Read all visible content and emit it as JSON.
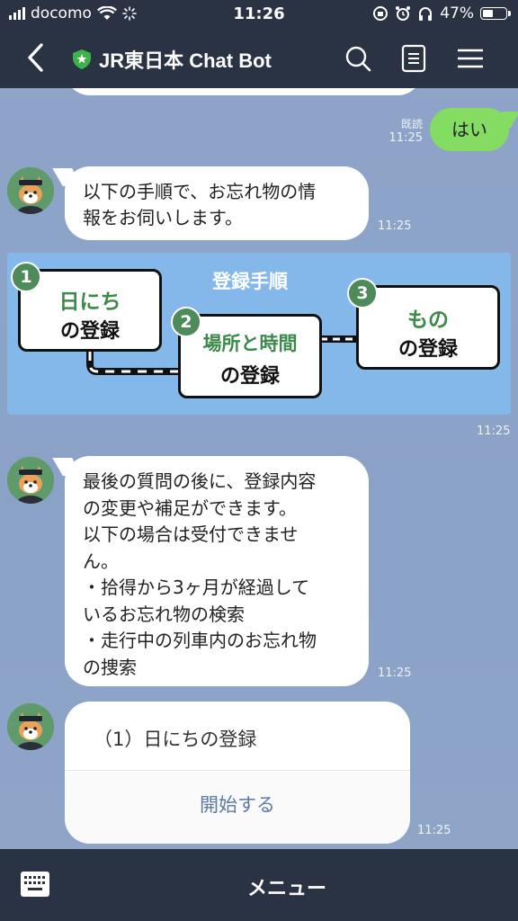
{
  "status_bar": {
    "carrier": "docomo",
    "time": "11:26",
    "battery": "47%"
  },
  "header": {
    "title": "JR東日本 Chat Bot"
  },
  "messages": {
    "prev_partial": "はい",
    "user_reply": {
      "text": "はい",
      "read_label": "既読",
      "time": "11:25"
    },
    "bot_intro": {
      "lines": [
        "以下の手順で、お忘れ物の情",
        "報をお伺いします。"
      ],
      "time": "11:25"
    },
    "banner": {
      "title": "登録手順",
      "steps": [
        {
          "num": "1",
          "line1": "日にち",
          "line2": "の登録"
        },
        {
          "num": "2",
          "line1": "場所と時間",
          "line2": "の登録"
        },
        {
          "num": "3",
          "line1": "もの",
          "line2": "の登録"
        }
      ],
      "time": "11:25"
    },
    "bot_notice": {
      "lines": [
        "最後の質問の後に、登録内容",
        "の変更や補足ができます。",
        "以下の場合は受付できませ",
        "ん。",
        "・拾得から3ヶ月が経過して",
        "いるお忘れ物の検索",
        "・走行中の列車内のお忘れ物",
        "の捜索"
      ],
      "time": "11:25"
    },
    "card": {
      "title": "（1）日にちの登録",
      "button": "開始する",
      "time": "11:25"
    }
  },
  "bottom_bar": {
    "menu_label": "メニュー"
  },
  "colors": {
    "header_bg": "#2a3344",
    "chat_bg": "#8ea5c8",
    "user_bubble": "#85dc62",
    "banner_bg": "#85b8ea",
    "step_green": "#4e8a5a"
  },
  "icons": [
    "back-icon",
    "shield-icon",
    "search-icon",
    "notes-icon",
    "menu-icon",
    "keyboard-icon"
  ]
}
